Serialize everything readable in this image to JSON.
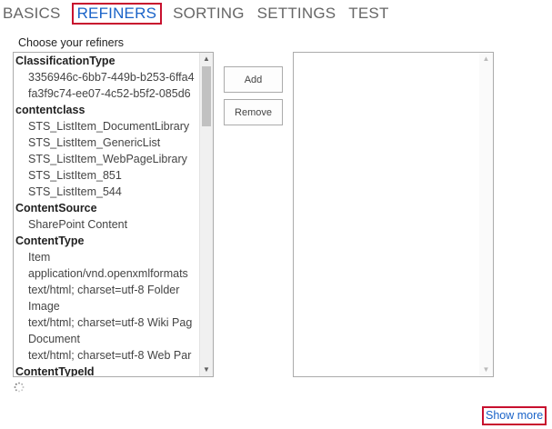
{
  "tabs": [
    {
      "label": "BASICS"
    },
    {
      "label": "REFINERS",
      "active": true
    },
    {
      "label": "SORTING"
    },
    {
      "label": "SETTINGS"
    },
    {
      "label": "TEST"
    }
  ],
  "refiners": {
    "label": "Choose your refiners",
    "available": [
      {
        "type": "group",
        "label": "ClassificationType"
      },
      {
        "type": "item",
        "label": "3356946c-6bb7-449b-b253-6ffa4"
      },
      {
        "type": "item",
        "label": "fa3f9c74-ee07-4c52-b5f2-085d6"
      },
      {
        "type": "group",
        "label": "contentclass"
      },
      {
        "type": "item",
        "label": "STS_ListItem_DocumentLibrary"
      },
      {
        "type": "item",
        "label": "STS_ListItem_GenericList"
      },
      {
        "type": "item",
        "label": "STS_ListItem_WebPageLibrary"
      },
      {
        "type": "item",
        "label": "STS_ListItem_851"
      },
      {
        "type": "item",
        "label": "STS_ListItem_544"
      },
      {
        "type": "group",
        "label": "ContentSource"
      },
      {
        "type": "item",
        "label": "SharePoint Content"
      },
      {
        "type": "group",
        "label": "ContentType"
      },
      {
        "type": "item",
        "label": "Item"
      },
      {
        "type": "item",
        "label": "application/vnd.openxmlformats"
      },
      {
        "type": "item",
        "label": "text/html; charset=utf-8 Folder"
      },
      {
        "type": "item",
        "label": "Image"
      },
      {
        "type": "item",
        "label": "text/html; charset=utf-8 Wiki Pag"
      },
      {
        "type": "item",
        "label": "Document"
      },
      {
        "type": "item",
        "label": "text/html; charset=utf-8 Web Par"
      },
      {
        "type": "group",
        "label": "ContentTypeId"
      }
    ],
    "add_label": "Add",
    "remove_label": "Remove",
    "selected": []
  },
  "show_more_label": "Show more",
  "colors": {
    "accent": "#1a63c8",
    "highlight_border": "#c8102e"
  },
  "icons": {
    "scroll_up": "triangle-up-icon",
    "scroll_down": "triangle-down-icon",
    "loading": "spinner-icon"
  }
}
